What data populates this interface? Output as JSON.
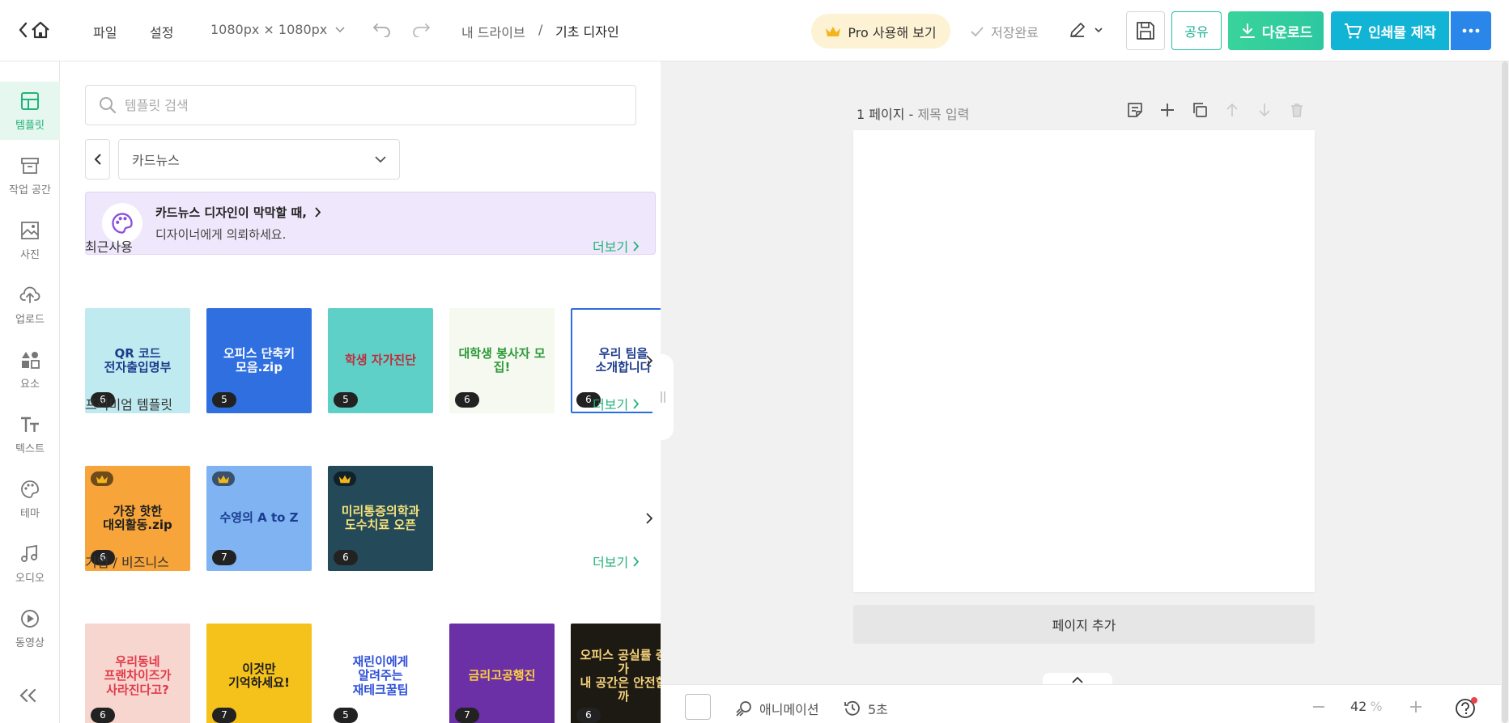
{
  "topbar": {
    "file_menu": "파일",
    "settings_menu": "설정",
    "canvas_size": "1080px × 1080px",
    "breadcrumb_root": "내 드라이브",
    "breadcrumb_sep": "/",
    "document_title": "기초 디자인",
    "pro_label": "Pro 사용해 보기",
    "save_status": "저장완료",
    "share_label": "공유",
    "download_label": "다운로드",
    "print_label": "인쇄물 제작"
  },
  "rail": {
    "items": [
      {
        "label": "템플릿",
        "icon": "template-icon",
        "active": true
      },
      {
        "label": "작업 공간",
        "icon": "workspace-icon"
      },
      {
        "label": "사진",
        "icon": "photo-icon"
      },
      {
        "label": "업로드",
        "icon": "upload-icon"
      },
      {
        "label": "요소",
        "icon": "elements-icon"
      },
      {
        "label": "텍스트",
        "icon": "text-icon"
      },
      {
        "label": "테마",
        "icon": "palette-icon"
      },
      {
        "label": "오디오",
        "icon": "audio-icon"
      },
      {
        "label": "동영상",
        "icon": "video-icon"
      }
    ]
  },
  "panel": {
    "search_placeholder": "템플릿 검색",
    "category_value": "카드뉴스",
    "banner_title": "카드뉴스 디자인이 막막할 때,",
    "banner_subtitle": "디자이너에게 의뢰하세요.",
    "more_label": "더보기",
    "sections": [
      {
        "title": "최근사용",
        "items": [
          {
            "lines": [
              "QR 코드",
              "전자출입명부"
            ],
            "count": "6",
            "bg": "#bfeaf0",
            "fg": "#1d3d8c"
          },
          {
            "lines": [
              "오피스 단축키",
              "모음.zip"
            ],
            "count": "5",
            "bg": "#2f6fe0",
            "fg": "#ffffff"
          },
          {
            "lines": [
              "학생 자가진단"
            ],
            "count": "5",
            "bg": "#5fd0c8",
            "fg": "#c02b3a"
          },
          {
            "lines": [
              "대학생 봉사자 모집!"
            ],
            "count": "6",
            "bg": "#f6f9ef",
            "fg": "#2c9a3a"
          },
          {
            "lines": [
              "우리 팀을",
              "소개합니다"
            ],
            "count": "6",
            "bg": "#ffffff",
            "fg": "#1d3c8c"
          }
        ]
      },
      {
        "title": "프리미엄 템플릿",
        "items": [
          {
            "lines": [
              "가장 핫한",
              "대외활동.zip"
            ],
            "count": "6",
            "bg": "#f7a53a",
            "fg": "#1c1c1c"
          },
          {
            "lines": [
              "수영의 A to Z"
            ],
            "count": "7",
            "bg": "#7fb3f2",
            "fg": "#1c3e91"
          },
          {
            "lines": [
              "미리통증의학과",
              "도수치료 오픈"
            ],
            "count": "6",
            "bg": "#244a5a",
            "fg": "#f6e27a"
          }
        ]
      },
      {
        "title": "기업 / 비즈니스",
        "items": [
          {
            "lines": [
              "우리동네",
              "프랜차이즈가",
              "사라진다고?"
            ],
            "count": "6",
            "bg": "#f6d6cf",
            "fg": "#e23a4a"
          },
          {
            "lines": [
              "이것만",
              "기억하세요!"
            ],
            "count": "7",
            "bg": "#f5c21b",
            "fg": "#1c1c1c"
          },
          {
            "lines": [
              "재린이에게",
              "알려주는",
              "재테크꿀팁"
            ],
            "count": "5",
            "bg": "#ffffff",
            "fg": "#2d4fd8"
          },
          {
            "lines": [
              "금리고공행진"
            ],
            "count": "7",
            "bg": "#6b2fa6",
            "fg": "#ffd23a"
          },
          {
            "lines": [
              "오피스 공실률 증가",
              "내 공간은 안전할까"
            ],
            "count": "6",
            "bg": "#1d1a14",
            "fg": "#f5d27a"
          }
        ]
      }
    ]
  },
  "canvas": {
    "page_label": "1 페이지 -",
    "title_placeholder": "제목 입력",
    "add_page_label": "페이지 추가"
  },
  "bottom": {
    "animation_label": "애니메이션",
    "duration_label": "5초",
    "zoom_value": "42",
    "zoom_unit": "%"
  }
}
